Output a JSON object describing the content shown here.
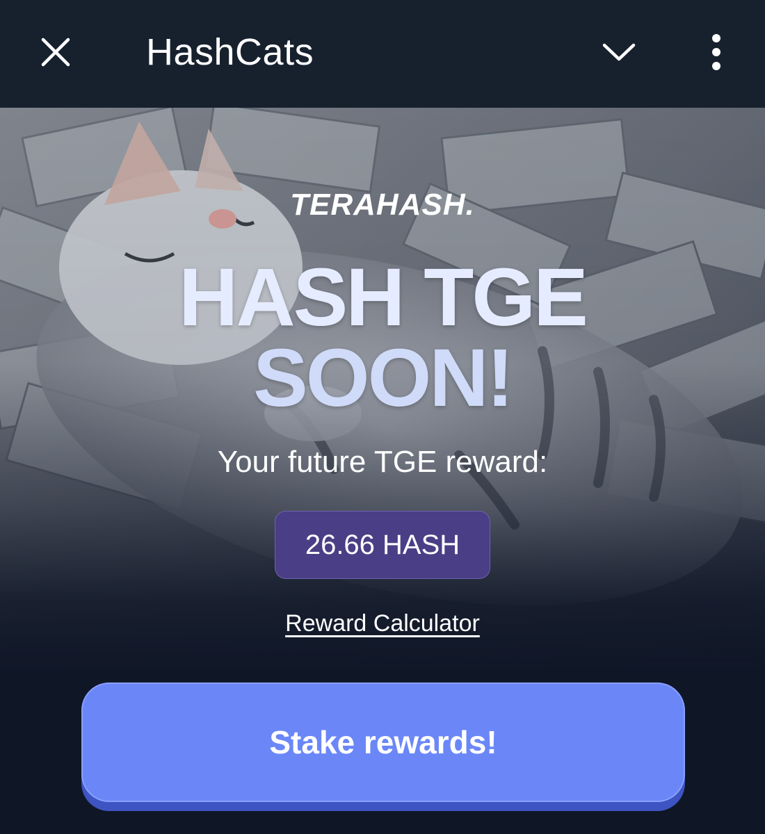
{
  "header": {
    "title": "HashCats",
    "close_icon": "close-icon",
    "chevron_icon": "chevron-down-icon",
    "menu_icon": "more-vertical-icon"
  },
  "hero": {
    "brand": "TERAHASH.",
    "headline_line1": "HASH TGE",
    "headline_line2": "SOON!",
    "reward_caption": "Your future TGE reward:",
    "reward_value": "26.66 HASH",
    "calculator_link": "Reward Calculator",
    "stake_button": "Stake rewards!"
  },
  "colors": {
    "header_bg": "#17212e",
    "page_bg": "#0f1626",
    "badge_bg": "#4a3f86",
    "button_bg": "#6b87f7",
    "button_shadow": "#3e54c2"
  }
}
